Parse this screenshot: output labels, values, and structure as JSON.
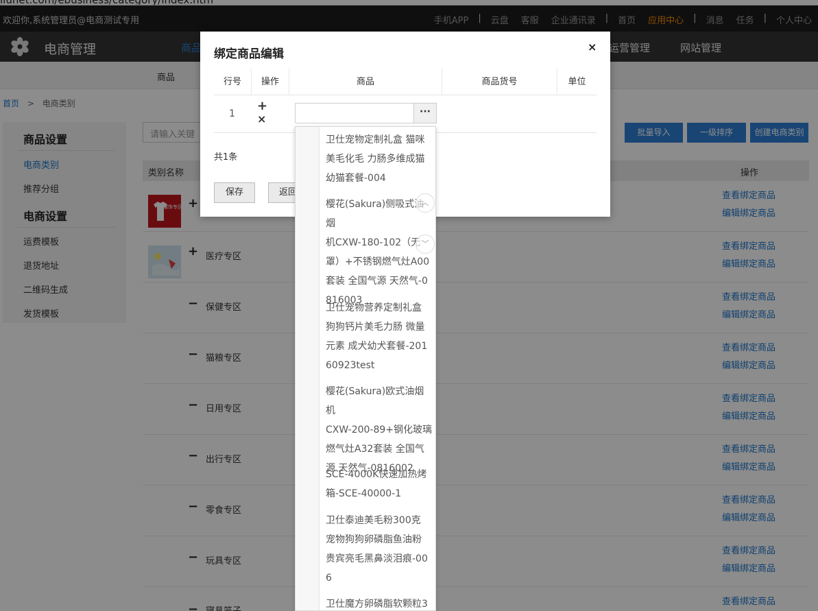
{
  "browser": {
    "url": "iiunet.com/ebusiness/category/index.htm"
  },
  "topbar": {
    "welcome": "欢迎你,系统管理员@电商测试专用",
    "links": [
      "手机APP",
      "云盘",
      "客服",
      "企业通讯录",
      "首页",
      "应用中心",
      "消息",
      "任务",
      "个人中心"
    ]
  },
  "nav": {
    "brand": "电商管理",
    "items": [
      "商品",
      "运营管理",
      "网站管理"
    ]
  },
  "subnav": {
    "item": "商品"
  },
  "breadcrumb": {
    "home": "首页",
    "sep": ">",
    "current": "电商类别"
  },
  "sidebar": {
    "section1": "商品设置",
    "items1": [
      "电商类别",
      "推荐分组"
    ],
    "section2": "电商设置",
    "items2": [
      "运费模板",
      "退货地址",
      "二维码生成",
      "发货模板"
    ]
  },
  "search": {
    "placeholder": "请输入关键"
  },
  "toolbar": {
    "import": "批量导入",
    "sort": "一级排序",
    "create": "创建电商类别"
  },
  "table": {
    "col_name": "类别名称",
    "col_ops": "操作",
    "act_view": "查看绑定商品",
    "act_edit": "编辑绑定商品",
    "rows": [
      {
        "name": "",
        "thumb_text": "服饰专区"
      },
      {
        "name": "医疗专区"
      },
      {
        "name": "保健专区"
      },
      {
        "name": "猫粮专区"
      },
      {
        "name": "日用专区"
      },
      {
        "name": "出行专区"
      },
      {
        "name": "零食专区"
      },
      {
        "name": "玩具专区"
      },
      {
        "name": "寝具笼子"
      }
    ]
  },
  "modal": {
    "title": "绑定商品编辑",
    "close": "×",
    "headers": [
      "行号",
      "操作",
      "商品",
      "商品货号",
      "单位"
    ],
    "row_no": "1",
    "add_op": "+",
    "del_op": "×",
    "more": "···",
    "total": "共1条",
    "save": "保存",
    "back": "返回"
  },
  "dropdown": {
    "options": [
      [
        "卫仕宠物定制礼盒 猫咪",
        "美毛化毛 力肠多维成猫",
        "幼猫套餐-004"
      ],
      [
        "樱花(Sakura)侧吸式油烟",
        "机CXW-180-102（无",
        "罩）+不锈钢燃气灶A00",
        "套装 全国气源 天然气-0",
        "816003"
      ],
      [
        "卫仕宠物营养定制礼盒",
        "狗狗钙片美毛力肠 微量",
        "元素 成犬幼犬套餐-201",
        "60923test"
      ],
      [
        "樱花(Sakura)欧式油烟机",
        "CXW-200-89+钢化玻璃",
        "燃气灶A32套装 全国气",
        "源 天然气-0816002"
      ],
      [
        "SCE-4000K快速加热烤",
        "箱-SCE-40000-1"
      ],
      [
        "卫仕泰迪美毛粉300克",
        "宠物狗狗卵磷脂鱼油粉",
        "贵宾亮毛黑鼻淡泪痕-00",
        "6"
      ],
      [
        "卫仕魔方卵磷脂软颗粒3"
      ]
    ]
  }
}
